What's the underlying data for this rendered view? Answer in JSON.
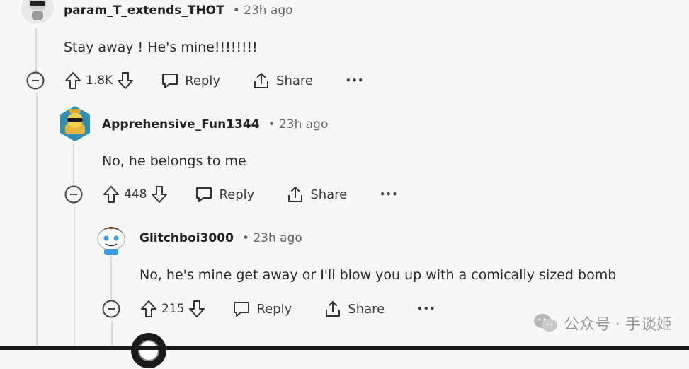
{
  "comments": [
    {
      "username": "param_T_extends_THOT",
      "time": "• 23h ago",
      "text": "Stay away ! He's mine!!!!!!!!",
      "score": "1.8K"
    },
    {
      "username": "Apprehensive_Fun1344",
      "time": "• 23h ago",
      "text": "No, he belongs to me",
      "score": "448"
    },
    {
      "username": "Glitchboi3000",
      "time": "• 23h ago",
      "text": "No, he's mine get away or I'll blow you up with a comically sized bomb",
      "score": "215"
    }
  ],
  "actions": {
    "reply_label": "Reply",
    "share_label": "Share",
    "more_label": "•••"
  },
  "watermark": {
    "text": "公众号 · 手谈姬"
  },
  "colors": {
    "background": "#f7f7f7",
    "thread_line": "#d9d9d9",
    "text": "#1c1c1c",
    "muted": "#666666"
  }
}
